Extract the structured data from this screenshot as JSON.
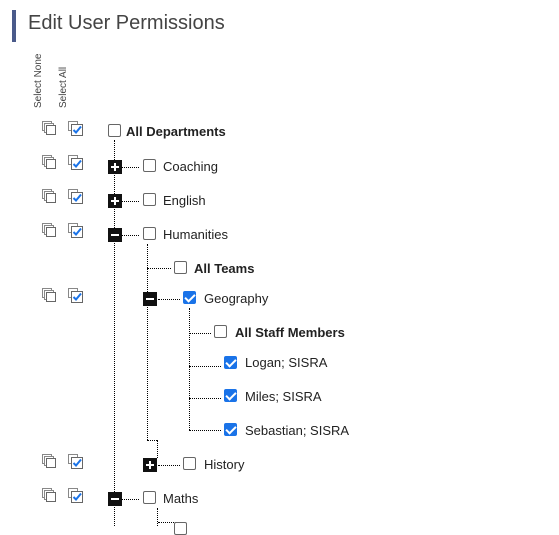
{
  "page": {
    "title": "Edit User Permissions",
    "select_none_label": "Select None",
    "select_all_label": "Select All"
  },
  "tree": {
    "all_departments": "All Departments",
    "coaching": "Coaching",
    "english": "English",
    "humanities": "Humanities",
    "all_teams": "All Teams",
    "geography": "Geography",
    "all_staff_members": "All Staff Members",
    "logan": "Logan; SISRA",
    "miles": "Miles; SISRA",
    "sebastian": "Sebastian; SISRA",
    "history": "History",
    "maths": "Maths"
  },
  "checked_state": {
    "all_departments": false,
    "coaching": false,
    "english": false,
    "humanities": false,
    "all_teams": false,
    "geography": true,
    "all_staff_members": false,
    "logan": true,
    "miles": true,
    "sebastian": true,
    "history": false,
    "maths": false
  },
  "icons": {
    "select_none": "select-none-icon",
    "select_all": "select-all-icon",
    "expand": "plus-icon",
    "collapse": "minus-icon"
  },
  "colors": {
    "accent": "#1a73e8",
    "title_bar": "#4a5a8a"
  }
}
